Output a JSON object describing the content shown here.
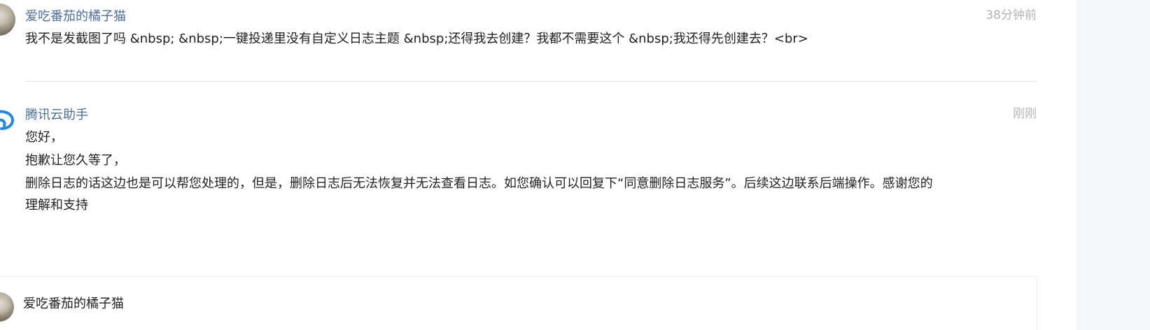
{
  "messages": [
    {
      "author": "爱吃番茄的橘子猫",
      "time": "38分钟前",
      "lines": [
        "我不是发截图了吗 &nbsp; &nbsp;一键投递里没有自定义日志主题 &nbsp;还得我去创建？我都不需要这个 &nbsp;我还得先创建去？<br>"
      ]
    },
    {
      "author": "腾讯云助手",
      "time": "刚刚",
      "lines": [
        "您好，",
        "抱歉让您久等了，",
        "删除日志的话这边也是可以帮您处理的，但是，删除日志后无法恢复并无法查看日志。如您确认可以回复下“同意删除日志服务”。后续这边联系后端操作。感谢您的",
        "理解和支持"
      ]
    }
  ],
  "reply_card": {
    "author": "爱吃番茄的橘子猫"
  },
  "icons": {
    "user_avatar": "user-photo-avatar",
    "assistant_avatar": "cloud-icon"
  },
  "colors": {
    "author_link": "#4a6fa5",
    "timestamp": "#b0b4ba",
    "assistant_blue": "#1e88e5"
  }
}
